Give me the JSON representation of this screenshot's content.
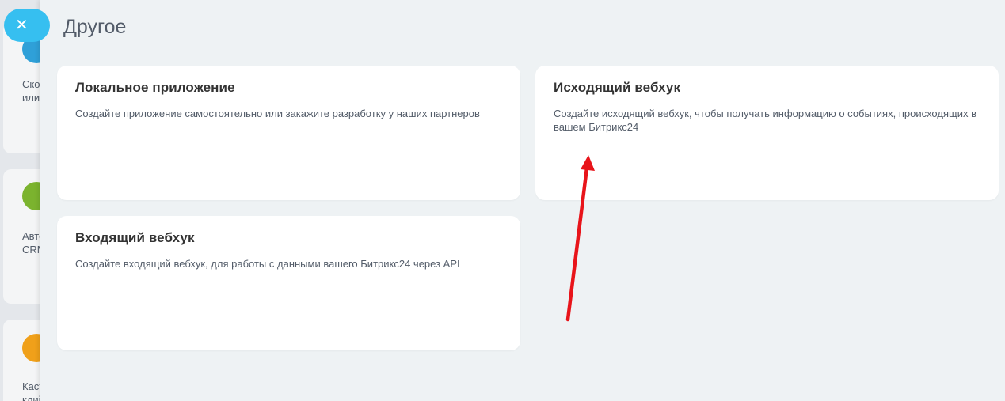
{
  "background": {
    "cards": [
      {
        "text_lines": [
          "Ско",
          "или"
        ],
        "icon_color": "#2fa0d8"
      },
      {
        "text_lines": [
          "Авто",
          "CRM"
        ],
        "icon_color": "#7bb32e"
      },
      {
        "text_lines": [
          "Каст",
          "клиі"
        ],
        "icon_color": "#f0a01a"
      }
    ]
  },
  "close_button": {
    "glyph": "✕"
  },
  "page_title": "Другое",
  "cards": [
    {
      "title": "Локальное приложение",
      "description": "Создайте приложение самостоятельно или закажите разработку у наших партнеров"
    },
    {
      "title": "Исходящий вебхук",
      "description": "Создайте исходящий вебхук, чтобы получать информацию о событиях, происходящих в вашем Битрикс24"
    },
    {
      "title": "Входящий вебхук",
      "description": "Создайте входящий вебхук, для работы с данными вашего Битрикс24 через API"
    }
  ],
  "annotation": {
    "color": "#e8141a"
  }
}
